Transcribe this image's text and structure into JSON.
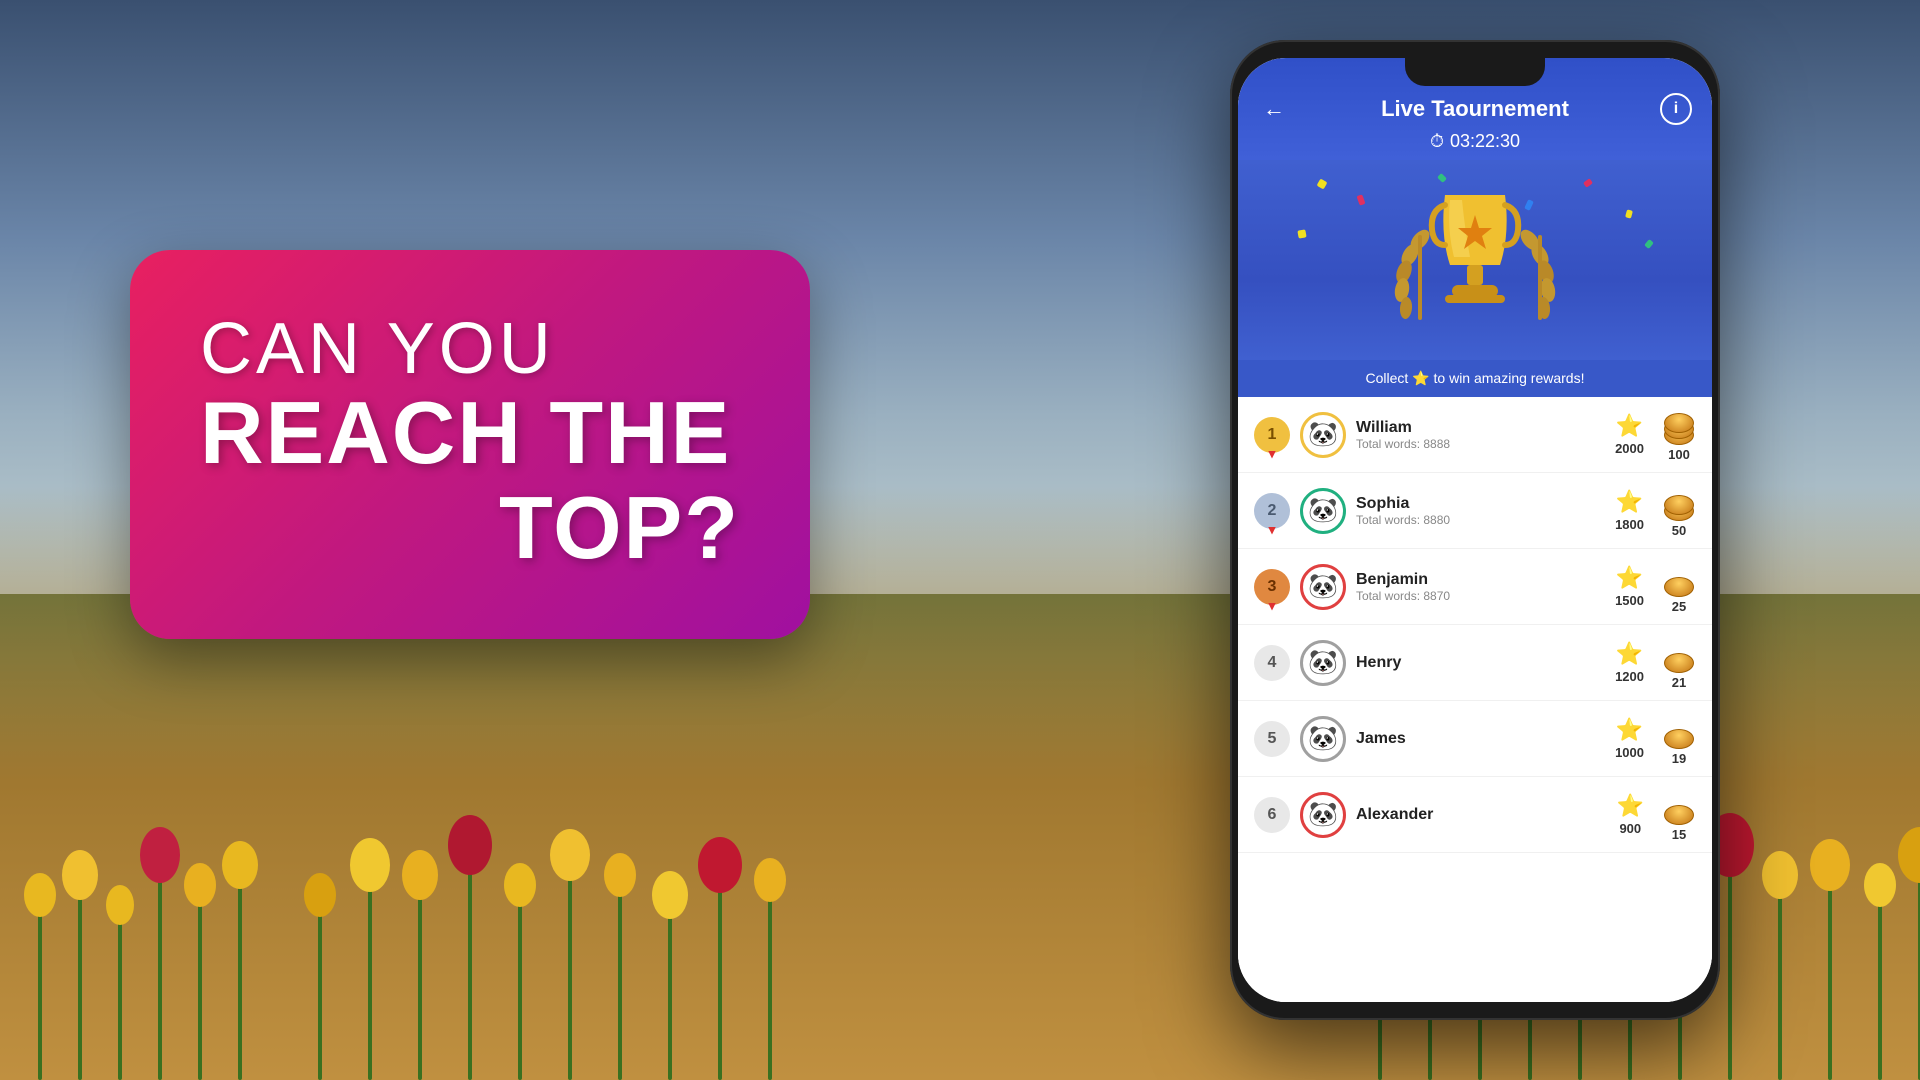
{
  "background": {
    "sky_color_top": "#3a5070",
    "sky_color_bottom": "#c0cfd0",
    "field_color": "#6a8050"
  },
  "promo": {
    "line1": "CAN YOU",
    "line2": "REACH THE",
    "line3": "TOP?"
  },
  "app": {
    "title": "Live Taournement",
    "timer": "03:22:30",
    "timer_icon": "⏱",
    "collect_text": "Collect ⭐ to win amazing rewards!",
    "back_icon": "←",
    "info_icon": "i",
    "leaderboard": [
      {
        "rank": 1,
        "name": "William",
        "sub": "Total words: 8888",
        "score": 2000,
        "coins": 100,
        "rank_style": "gold"
      },
      {
        "rank": 2,
        "name": "Sophia",
        "sub": "Total words: 8880",
        "score": 1800,
        "coins": 50,
        "rank_style": "silver"
      },
      {
        "rank": 3,
        "name": "Benjamin",
        "sub": "Total words: 8870",
        "score": 1500,
        "coins": 25,
        "rank_style": "bronze"
      },
      {
        "rank": 4,
        "name": "Henry",
        "sub": "",
        "score": 1200,
        "coins": 21,
        "rank_style": "plain"
      },
      {
        "rank": 5,
        "name": "James",
        "sub": "",
        "score": 1000,
        "coins": 19,
        "rank_style": "plain"
      },
      {
        "rank": 6,
        "name": "Alexander",
        "sub": "",
        "score": 900,
        "coins": 15,
        "rank_style": "plain"
      }
    ]
  }
}
